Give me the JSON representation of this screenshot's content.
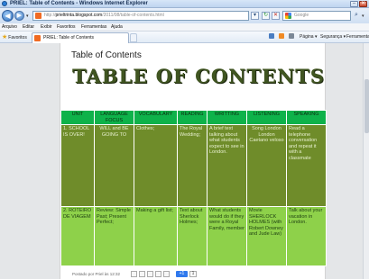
{
  "window": {
    "title": "PRIEL: Table of Contents - Windows Internet Explorer",
    "min_glyph": "–",
    "close_glyph": "✕"
  },
  "navigation": {
    "back_glyph": "◀",
    "forward_glyph": "▶",
    "dropdown_glyph": "▾",
    "url_prefix": "http://",
    "url_domain": "prieltrinta.blogspot.com",
    "url_path": "/2011/08/table-of-contents.html",
    "refresh_glyph": "↻",
    "stop_glyph": "✕",
    "search_placeholder": "Google",
    "search_glyph": "⌕"
  },
  "menu": {
    "items": [
      "Arquivo",
      "Editar",
      "Exibir",
      "Favoritos",
      "Ferramentas",
      "Ajuda"
    ]
  },
  "favorites_bar": {
    "favorites_label": "Favoritos",
    "tab_label": "PRIEL: Table of Contents",
    "commands": [
      "Página ▾",
      "Segurança ▾",
      "Ferramentas ▾"
    ]
  },
  "post": {
    "title": "Table of Contents",
    "banner": "TABLE OF CONTENTS",
    "footer": "Postado por Priel às 12:32",
    "plus_one": "+1",
    "plus_count": "1"
  },
  "table": {
    "headers": [
      "UNIT",
      "LANGUAGE FOCUS",
      "VOCABULARY",
      "READING",
      "WRITTING",
      "LISTENING",
      "SPEAKING"
    ],
    "rows": [
      [
        "1. SCHOOL IS OVER!",
        "WILL and BE GOING TO",
        "Clothes;",
        "The Royal Wedding;",
        "A brief text talking about what students expect to see in London.",
        "Song London London Caetano veloso",
        "Read a telephone conversation and repeat it with a classmate"
      ],
      [
        "2. ROTEIRO DE VIAGEM",
        "Review: Simple Past; Present Perfect;",
        "Making a gift list;",
        "Text about Sherlock Holmes;",
        "What students would do if they were a Royal Family, member",
        "Movie SHERLOCK HOLMES (with Robert Downey and Jude Law)",
        "Talk about your vacation in London."
      ]
    ]
  },
  "colors": {
    "header_bg": "#0eb24a",
    "row1_bg": "#6f8c2a",
    "row2_bg": "#8ed14a",
    "banner_text": "#405521"
  }
}
